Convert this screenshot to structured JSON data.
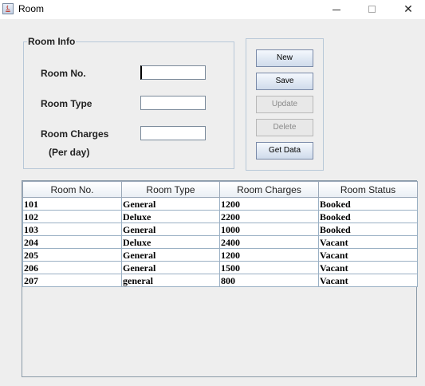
{
  "window": {
    "title": "Room",
    "minimize": "—",
    "close": "✕"
  },
  "room_info": {
    "legend": "Room Info",
    "room_no_label": "Room No.",
    "room_type_label": "Room Type",
    "room_charges_label": "Room Charges",
    "per_day_label": "(Per day)",
    "room_no_value": "",
    "room_type_value": "",
    "room_charges_value": ""
  },
  "buttons": {
    "new": "New",
    "save": "Save",
    "update": "Update",
    "delete": "Delete",
    "get_data": "Get Data",
    "update_enabled": false,
    "delete_enabled": false
  },
  "table": {
    "headers": [
      "Room No.",
      "Room Type",
      "Room Charges",
      "Room Status"
    ],
    "rows": [
      [
        "101",
        "General",
        "1200",
        "Booked"
      ],
      [
        "102",
        "Deluxe",
        "2200",
        "Booked"
      ],
      [
        "103",
        "General",
        "1000",
        "Booked"
      ],
      [
        "204",
        "Deluxe",
        "2400",
        "Vacant"
      ],
      [
        "205",
        "General",
        "1200",
        "Vacant"
      ],
      [
        "206",
        "General",
        "1500",
        "Vacant"
      ],
      [
        "207",
        "general",
        "800",
        "Vacant"
      ]
    ]
  }
}
